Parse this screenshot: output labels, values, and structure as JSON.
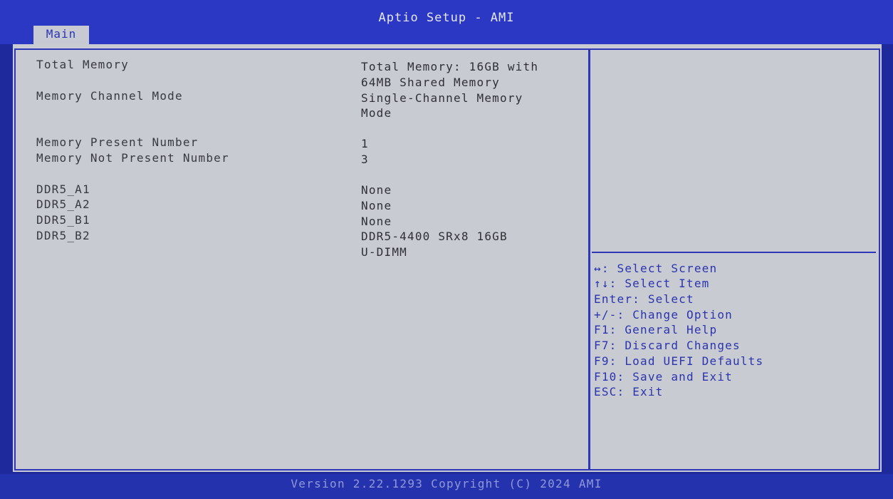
{
  "header": {
    "title": "Aptio Setup - AMI",
    "tabs": [
      {
        "label": "Main"
      }
    ]
  },
  "main": {
    "rows": [
      {
        "label": "Total Memory",
        "value": [
          "Total Memory: 16GB with",
          "64MB Shared Memory"
        ]
      },
      {
        "label": "Memory Channel Mode",
        "value": [
          "Single-Channel Memory",
          "Mode"
        ]
      },
      {
        "label": "Memory Present Number",
        "value": [
          "1"
        ]
      },
      {
        "label": "Memory Not Present Number",
        "value": [
          "3"
        ]
      },
      {
        "label": "DDR5_A1",
        "value": [
          "None"
        ]
      },
      {
        "label": "DDR5_A2",
        "value": [
          "None"
        ]
      },
      {
        "label": "DDR5_B1",
        "value": [
          "None"
        ]
      },
      {
        "label": "DDR5_B2",
        "value": [
          "DDR5-4400 SRx8 16GB",
          "U-DIMM"
        ]
      }
    ]
  },
  "help": {
    "items": [
      {
        "key": "↔:",
        "text": "Select Screen"
      },
      {
        "key": "↑↓:",
        "text": "Select Item"
      },
      {
        "key": "Enter:",
        "text": "Select"
      },
      {
        "key": "+/-:",
        "text": "Change Option"
      },
      {
        "key": "F1:",
        "text": "General Help"
      },
      {
        "key": "F7:",
        "text": "Discard Changes"
      },
      {
        "key": "F9:",
        "text": "Load UEFI Defaults"
      },
      {
        "key": "F10:",
        "text": "Save and Exit"
      },
      {
        "key": "ESC:",
        "text": "Exit"
      }
    ]
  },
  "footer": {
    "text": "Version 2.22.1293 Copyright (C) 2024 AMI"
  },
  "colors": {
    "background_blue": "#1e2a9c",
    "panel_gray": "#c8cbd2",
    "help_text": "#2b34ae",
    "border": "#3036b8"
  }
}
